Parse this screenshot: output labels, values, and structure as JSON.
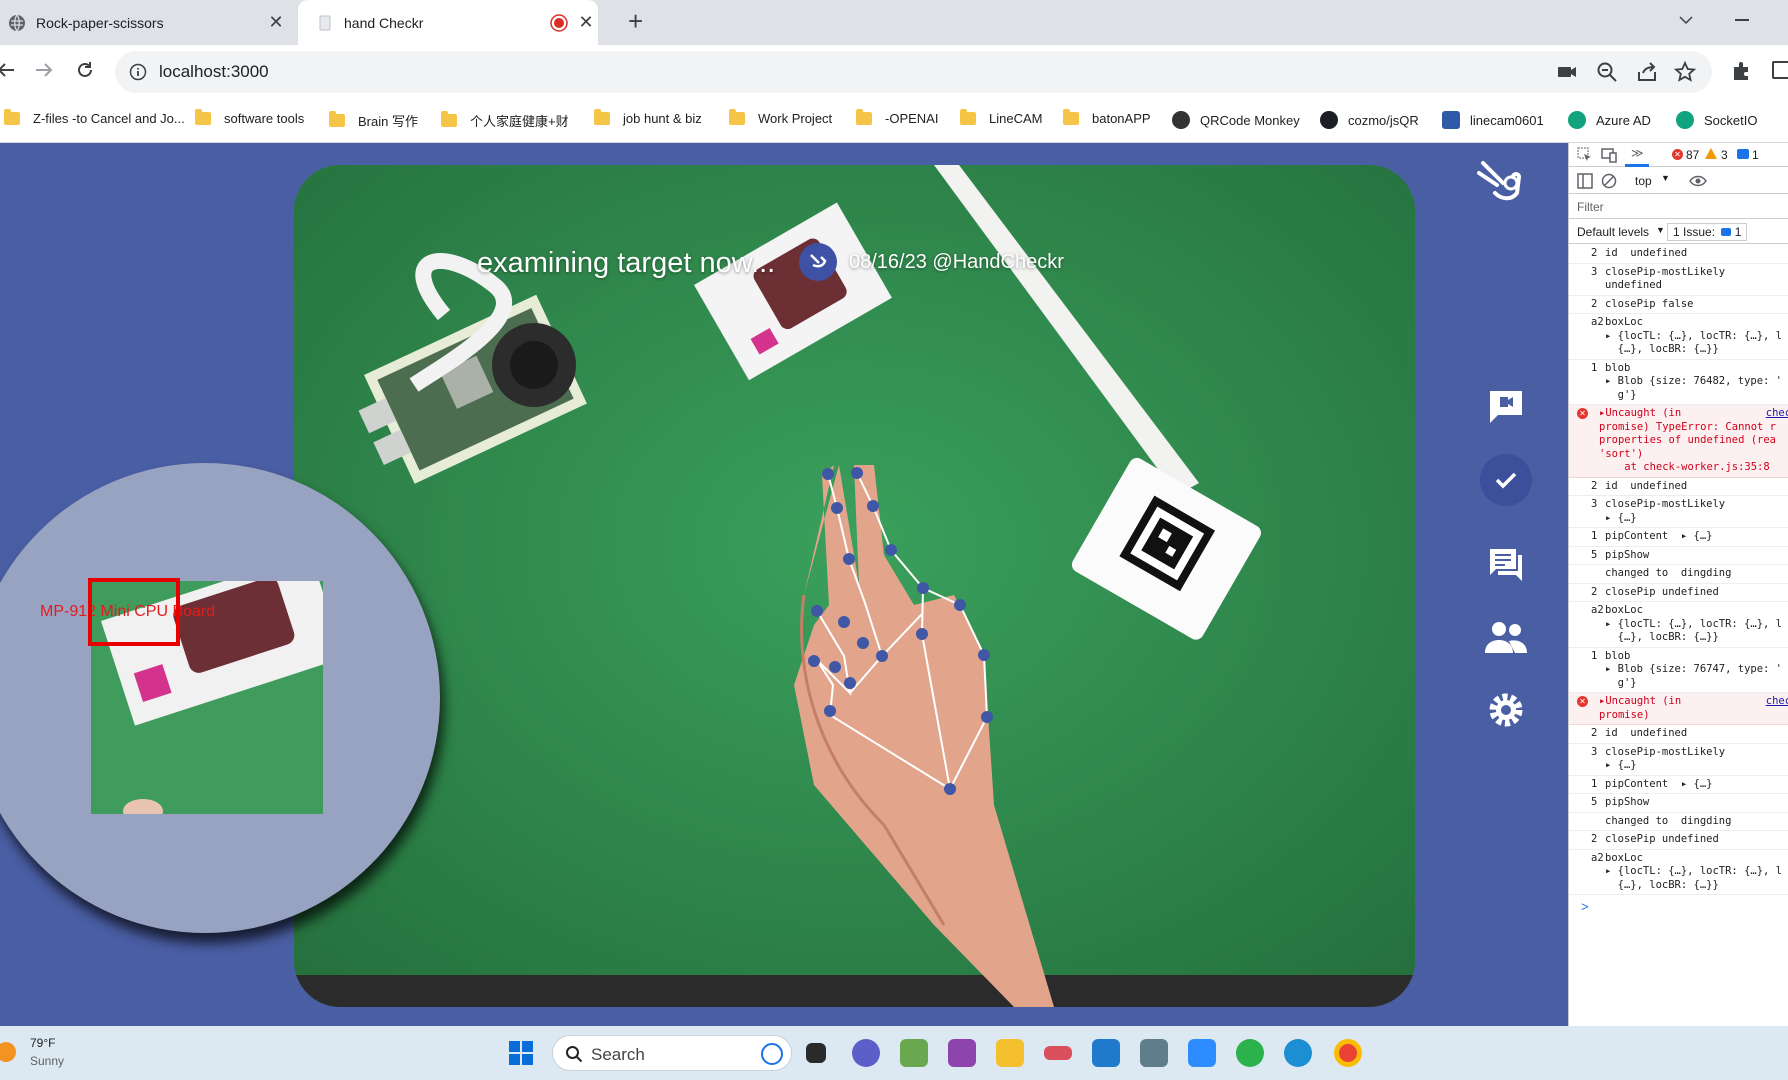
{
  "browser": {
    "tabs": [
      {
        "title": "Rock-paper-scissors",
        "active": false
      },
      {
        "title": "hand Checkr",
        "active": true,
        "recording": true
      }
    ],
    "new_tab": "+",
    "url": "localhost:3000"
  },
  "bookmarks": [
    {
      "label": "Z-files -to Cancel and Jo...",
      "icon": "folder-icon"
    },
    {
      "label": "software tools",
      "icon": "folder-icon"
    },
    {
      "label": "Brain 写作",
      "icon": "folder-icon"
    },
    {
      "label": "个人家庭健康+财",
      "icon": "folder-icon"
    },
    {
      "label": "job hunt & biz",
      "icon": "folder-icon"
    },
    {
      "label": "Work Project",
      "icon": "folder-icon"
    },
    {
      "label": "-OPENAI",
      "icon": "folder-icon"
    },
    {
      "label": "LineCAM",
      "icon": "folder-icon"
    },
    {
      "label": "batonAPP",
      "icon": "folder-icon"
    },
    {
      "label": "QRCode Monkey",
      "icon": "monkey-icon"
    },
    {
      "label": "cozmo/jsQR",
      "icon": "github-icon"
    },
    {
      "label": "linecam0601",
      "icon": "linecam-icon"
    },
    {
      "label": "Azure AD",
      "icon": "openai-icon"
    },
    {
      "label": "SocketIO",
      "icon": "openai-icon"
    }
  ],
  "app": {
    "status_text": "examining target now...",
    "date_watermark": "08/16/23 @HandCheckr",
    "pip_label": "MP-912  Mini CPU Board",
    "nav": [
      "feedback-icon",
      "check-icon",
      "chat-icon",
      "people-icon",
      "settings-icon"
    ],
    "accent": "#4a5ea4"
  },
  "devtools": {
    "errors": "87",
    "warnings": "3",
    "info": "1",
    "context": "top",
    "filter_placeholder": "Filter",
    "levels": "Default levels",
    "issues": "1 Issue:",
    "issues_count": "1",
    "prompt": ">",
    "logs": [
      {
        "n": "2",
        "text": "id  undefined",
        "src": "camera"
      },
      {
        "n": "3",
        "text": "closePip-mostLikely\nundefined",
        "src": "camera"
      },
      {
        "n": "2",
        "text": "closePip false",
        "src": "camera"
      },
      {
        "n": "a2",
        "text": "boxLoc\n▸ {locTL: {…}, locTR: {…}, l\n  {…}, locBR: {…}}",
        "src": "lib"
      },
      {
        "n": "1",
        "text": "blob\n▸ Blob {size: 76482, type: '\n  g'}",
        "src": "camera"
      },
      {
        "n": "",
        "text": "▸Uncaught (in\npromise) TypeError: Cannot r\nproperties of undefined (rea\n'sort')\n    at check-worker.js:35:8",
        "src": "check-work",
        "error": true
      },
      {
        "n": "2",
        "text": "id  undefined",
        "src": "camera"
      },
      {
        "n": "3",
        "text": "closePip-mostLikely\n▸ {…}",
        "src": "camera"
      },
      {
        "n": "1",
        "text": "pipContent  ▸ {…}",
        "src": "camera"
      },
      {
        "n": "5",
        "text": "pipShow",
        "src": "camera"
      },
      {
        "n": "",
        "text": "changed to  dingding",
        "src": "li"
      },
      {
        "n": "2",
        "text": "closePip undefined",
        "src": "camera"
      },
      {
        "n": "a2",
        "text": "boxLoc\n▸ {locTL: {…}, locTR: {…}, l\n  {…}, locBR: {…}}",
        "src": "lib"
      },
      {
        "n": "1",
        "text": "blob\n▸ Blob {size: 76747, type: '\n  g'}",
        "src": "camera"
      },
      {
        "n": "",
        "text": "▸Uncaught (in\npromise)",
        "src": "check-work",
        "error": true
      },
      {
        "n": "2",
        "text": "id  undefined",
        "src": "camera"
      },
      {
        "n": "3",
        "text": "closePip-mostLikely\n▸ {…}",
        "src": "camera"
      },
      {
        "n": "1",
        "text": "pipContent  ▸ {…}",
        "src": "camera"
      },
      {
        "n": "5",
        "text": "pipShow",
        "src": "camera"
      },
      {
        "n": "",
        "text": "changed to  dingding",
        "src": "li"
      },
      {
        "n": "2",
        "text": "closePip undefined",
        "src": "camera"
      },
      {
        "n": "a2",
        "text": "boxLoc\n▸ {locTL: {…}, locTR: {…}, l\n  {…}, locBR: {…}}",
        "src": "lib"
      }
    ]
  },
  "taskbar": {
    "temperature": "79°F",
    "condition": "Sunny",
    "search_label": "Search"
  }
}
